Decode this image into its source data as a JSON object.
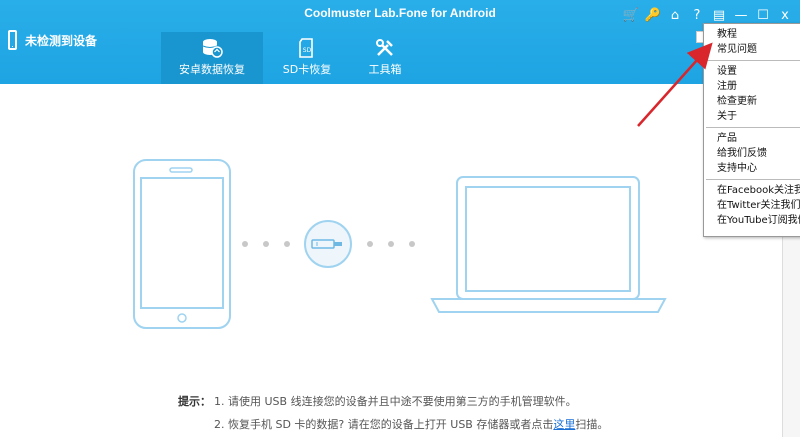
{
  "app": {
    "title": "Coolmuster Lab.Fone for Android"
  },
  "device": {
    "status": "未检测到设备"
  },
  "tabs": [
    {
      "label": "安卓数据恢复",
      "icon": "database-restore-icon",
      "active": true
    },
    {
      "label": "SD卡恢复",
      "icon": "sd-card-icon",
      "active": false
    },
    {
      "label": "工具箱",
      "icon": "tools-icon",
      "active": false
    }
  ],
  "window_icons": [
    {
      "name": "cart-icon",
      "glyph": "🛒"
    },
    {
      "name": "key-icon",
      "glyph": "🔑"
    },
    {
      "name": "home-icon",
      "glyph": "⌂"
    },
    {
      "name": "help-icon",
      "glyph": "?"
    },
    {
      "name": "feedback-icon",
      "glyph": "▤"
    },
    {
      "name": "minimize-icon",
      "glyph": "—"
    },
    {
      "name": "maximize-icon",
      "glyph": "☐"
    },
    {
      "name": "close-icon",
      "glyph": "x"
    }
  ],
  "tips": {
    "label": "提示：",
    "line1": "1. 请使用 USB 线连接您的设备并且中途不要使用第三方的手机管理软件。",
    "line2_prefix": "2. 恢复手机 SD 卡的数据? 请在您的设备上打开 USB 存储器或者点击",
    "line2_link": "这里",
    "line2_suffix": "扫描。"
  },
  "menu": {
    "group1": [
      "教程",
      "常见问题"
    ],
    "group2": [
      "设置",
      "注册",
      "检查更新",
      "关于"
    ],
    "group3": [
      "产品",
      "给我们反馈",
      "支持中心"
    ],
    "group4": [
      "在Facebook关注我们",
      "在Twitter关注我们",
      "在YouTube订阅我们"
    ]
  },
  "colors": {
    "header": "#22a9e6",
    "active_tab": "#1996d0",
    "illustration": "#9fd3f0",
    "arrow": "#d9262c"
  }
}
